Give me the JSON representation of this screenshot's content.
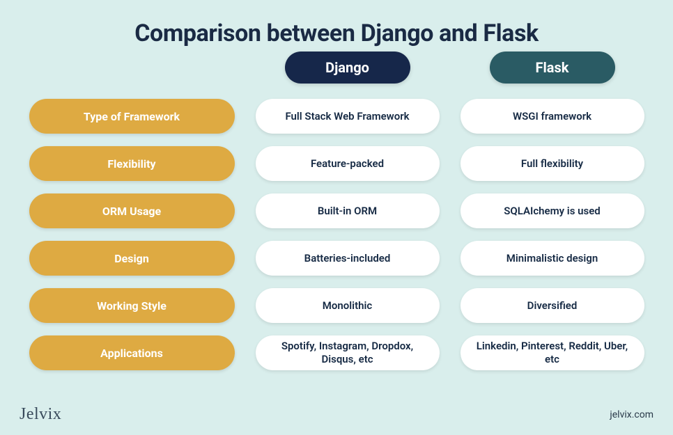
{
  "title": "Comparison between Django and Flask",
  "columns": {
    "left": "Django",
    "right": "Flask"
  },
  "rows": [
    {
      "name": "Type of Framework",
      "django": "Full Stack Web Framework",
      "flask": "WSGI framework"
    },
    {
      "name": "Flexibility",
      "django": "Feature-packed",
      "flask": "Full flexibility"
    },
    {
      "name": "ORM Usage",
      "django": "Built-in ORM",
      "flask": "SQLAIchemy is used"
    },
    {
      "name": "Design",
      "django": "Batteries-included",
      "flask": "Minimalistic design"
    },
    {
      "name": "Working Style",
      "django": "Monolithic",
      "flask": "Diversified"
    },
    {
      "name": "Applications",
      "django": "Spotify, Instagram, Dropdox, Disqus, etc",
      "flask": "Linkedin, Pinterest, Reddit, Uber, etc"
    }
  ],
  "footer": {
    "brand": "Jelvix",
    "url": "jelvix.com"
  }
}
